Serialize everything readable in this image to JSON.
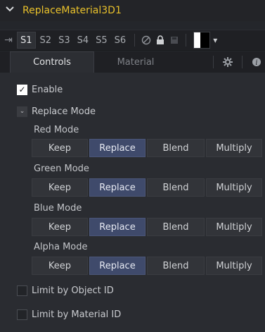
{
  "node": {
    "title": "ReplaceMaterial3D1"
  },
  "version_tabs": [
    "S1",
    "S2",
    "S3",
    "S4",
    "S5",
    "S6"
  ],
  "tabs": {
    "controls": "Controls",
    "material": "Material"
  },
  "controls": {
    "enable_label": "Enable",
    "replace_mode_label": "Replace Mode",
    "modes": [
      {
        "label": "Red Mode",
        "options": [
          "Keep",
          "Replace",
          "Blend",
          "Multiply"
        ],
        "selected": "Replace"
      },
      {
        "label": "Green Mode",
        "options": [
          "Keep",
          "Replace",
          "Blend",
          "Multiply"
        ],
        "selected": "Replace"
      },
      {
        "label": "Blue Mode",
        "options": [
          "Keep",
          "Replace",
          "Blend",
          "Multiply"
        ],
        "selected": "Replace"
      },
      {
        "label": "Alpha Mode",
        "options": [
          "Keep",
          "Replace",
          "Blend",
          "Multiply"
        ],
        "selected": "Replace"
      }
    ],
    "limit_object_label": "Limit by Object ID",
    "limit_material_label": "Limit by Material ID"
  },
  "icons": {
    "chevron": "chevron-down-icon",
    "pin": "pin-icon",
    "reset": "disable-icon",
    "lock": "lock-icon",
    "gear": "gear-icon",
    "info": "info-icon"
  },
  "colors": {
    "title": "#e9c12b",
    "selected_button": "#3f4a6b"
  }
}
